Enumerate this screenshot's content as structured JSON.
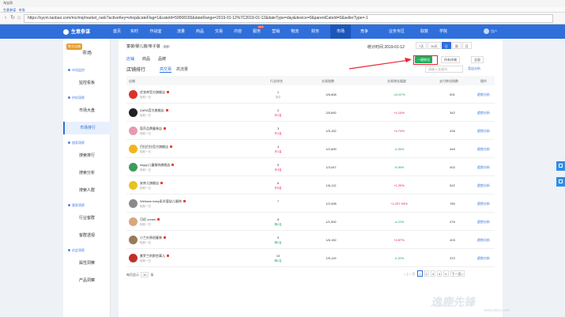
{
  "browser": {
    "title": "淘宝网",
    "bookmarks": "生意参谋 · 市场",
    "url": "https://sycm.taobao.com/mc/mq/market_rank?activeKey=shop&cateFlag=1&cateId=50008165&dateRange=2019-01-12%7C2019-01-12&dateType=day&device=0&parentCateId=0&sellerType=-1"
  },
  "topnav": {
    "brand": "生意参谋",
    "items": [
      {
        "label": "首页"
      },
      {
        "label": "实时"
      },
      {
        "label": "作战室"
      },
      {
        "label": "流量"
      },
      {
        "label": "商品"
      },
      {
        "label": "交易"
      },
      {
        "label": "内容"
      },
      {
        "label": "服务"
      },
      {
        "label": "营销"
      },
      {
        "label": "物流"
      },
      {
        "label": "财务"
      },
      {
        "label": "市场"
      },
      {
        "label": "竞争"
      },
      {
        "label": "业务专区"
      },
      {
        "label": "取数"
      },
      {
        "label": "学院"
      }
    ],
    "hot_badge": "HOT",
    "user": "用户"
  },
  "sidebar": {
    "shop_badge": "数字店铺",
    "title": "市场",
    "sections": [
      {
        "label": "市场监控",
        "items": [
          "监控看板"
        ]
      },
      {
        "label": "供给洞察",
        "items": [
          "市场大盘",
          "市场排行"
        ]
      },
      {
        "label": "搜索洞察",
        "items": [
          "搜索排行",
          "搜索分析",
          "搜索人群"
        ]
      },
      {
        "label": "客群洞察",
        "items": [
          "行业客群",
          "客群透视"
        ]
      },
      {
        "label": "机会洞察",
        "items": [
          "属性洞察",
          "产品洞察"
        ]
      }
    ]
  },
  "main": {
    "category": "童装/婴儿装/亲子装",
    "category_tag": "全部",
    "stat_time": "统计时间 2019-01-12",
    "periods": [
      "7天",
      "30天",
      "日",
      "周",
      "月"
    ],
    "active_period": "日",
    "top_tabs": [
      "店铺",
      "商品",
      "品牌"
    ],
    "btn_one_click": "一键转化",
    "terminal_select": "所有终端",
    "all_select": "全部",
    "ranking_title": "店铺排行",
    "sub_tabs": [
      "高交易",
      "高流量"
    ],
    "search_placeholder": "请输入关键词",
    "history": "竞店分析",
    "columns": [
      "店铺",
      "行业排名",
      "交易指数",
      "交易增长幅度",
      "支付转化指数",
      "操作"
    ],
    "rows": [
      {
        "name": "优衣库官方旗舰店",
        "meta": "较前一日",
        "rank": "1",
        "chg": "持平",
        "trade": "2/6,608",
        "growth": "-19.67%",
        "conv": "691",
        "op": "趋势分析",
        "color": "#d9332b"
      },
      {
        "name": "ZARA官方旗舰店",
        "meta": "较前一日",
        "rank": "2",
        "chg": "升1名",
        "trade": "2/5,692",
        "growth": "+4.14%",
        "conv": "342",
        "op": "趋势分析",
        "color": "#222222"
      },
      {
        "name": "笛莎品牌童装店",
        "meta": "较前一日",
        "rank": "3",
        "chg": "升1名",
        "trade": "1/5,152",
        "growth": "+4.74%",
        "conv": "426",
        "op": "趋势分析",
        "color": "#e79ab0"
      },
      {
        "name": "巴拉巴拉官方旗舰店",
        "meta": "较前一日",
        "rank": "4",
        "chg": "升1名",
        "trade": "1/2,699",
        "growth": "-4.26%",
        "conv": "449",
        "op": "趋势分析",
        "color": "#f2b51e"
      },
      {
        "name": "skypp儿童服饰旗舰店",
        "meta": "较前一日",
        "rank": "5",
        "chg": "升3名",
        "trade": "1/3,047",
        "growth": "-9.06%",
        "conv": "402",
        "op": "趋势分析",
        "color": "#3d9b5a"
      },
      {
        "name": "安奈儿旗舰店",
        "meta": "较前一日",
        "rank": "6",
        "chg": "升5名",
        "trade": "1/6,112",
        "growth": "+1.20%",
        "conv": "522",
        "op": "趋势分析",
        "color": "#e8c31f"
      },
      {
        "name": "Wellowe baby彩羊婴幼儿服饰",
        "meta": "较前一日",
        "rank": "7",
        "chg": "",
        "trade": "1/2,008",
        "growth": "+1,237.94%",
        "conv": "780",
        "op": "趋势分析",
        "color": "#8a8a8a"
      },
      {
        "name": "可优 cream",
        "meta": "较前一日",
        "rank": "8",
        "chg": "降1名",
        "trade": "1/1,592",
        "growth": "-4.22%",
        "conv": "476",
        "op": "趋势分析",
        "color": "#d7a77e"
      },
      {
        "name": "小兰衫原创童装",
        "meta": "较前一日",
        "rank": "9",
        "chg": "降1名",
        "trade": "1/6,152",
        "growth": "+4.57%",
        "conv": "403",
        "op": "趋势分析",
        "color": "#9a7a5c"
      },
      {
        "name": "紫罗兰的那些事儿",
        "meta": "较前一日",
        "rank": "10",
        "chg": "降1名",
        "trade": "1/9,119",
        "growth": "-2.20%",
        "conv": "370",
        "op": "趋势分析",
        "color": "#c0302a"
      }
    ],
    "page_size_label": "每页显示",
    "page_size": "10",
    "page_unit": "条",
    "pager": [
      "<上一页",
      "1",
      "2",
      "3",
      "4",
      "5",
      "下一页>"
    ],
    "active_page": "1"
  },
  "watermark": {
    "brand": "逸鹿先锋",
    "url": "www.yilux.com"
  }
}
